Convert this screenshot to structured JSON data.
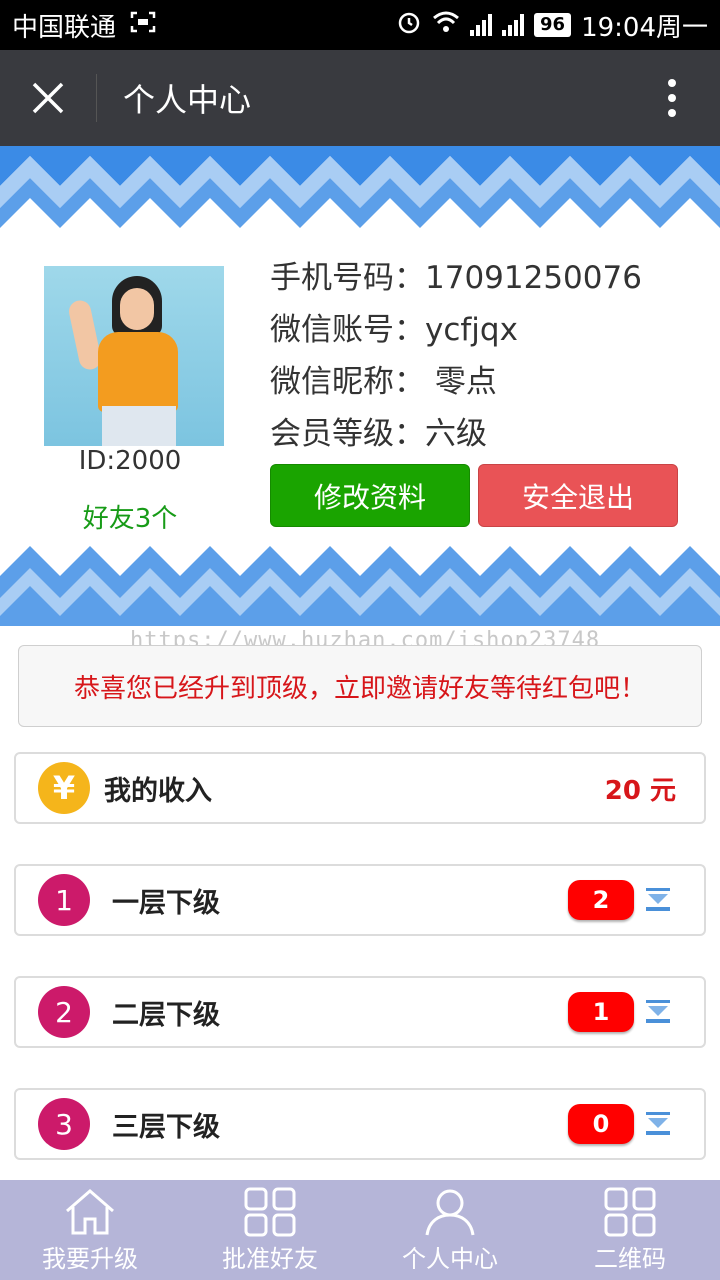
{
  "status_bar": {
    "carrier": "中国联通",
    "battery": "96",
    "time": "19:04周一"
  },
  "app_bar": {
    "title": "个人中心"
  },
  "profile": {
    "user_id": "ID:2000",
    "friends": "好友3个",
    "phone": "手机号码：17091250076",
    "wechat_account": "微信账号：ycfjqx",
    "wechat_nickname": "微信昵称： 零点",
    "member_level": "会员等级：六级",
    "edit_button": "修改资料",
    "logout_button": "安全退出",
    "colors": {
      "edit": "#1aa400",
      "logout": "#e95356"
    }
  },
  "watermark": "https://www.huzhan.com/ishop23748",
  "notice": "恭喜您已经升到顶级，立即邀请好友等待红包吧！",
  "income": {
    "label": "我的收入",
    "coin_symbol": "¥",
    "amount": "20 元"
  },
  "levels": [
    {
      "num": "1",
      "label": "一层下级",
      "count": "2"
    },
    {
      "num": "2",
      "label": "二层下级",
      "count": "1"
    },
    {
      "num": "3",
      "label": "三层下级",
      "count": "0"
    }
  ],
  "tabs": [
    {
      "label": "我要升级",
      "icon": "home-icon"
    },
    {
      "label": "批准好友",
      "icon": "grid-icon"
    },
    {
      "label": "个人中心",
      "icon": "person-icon"
    },
    {
      "label": "二维码",
      "icon": "grid-icon"
    }
  ]
}
